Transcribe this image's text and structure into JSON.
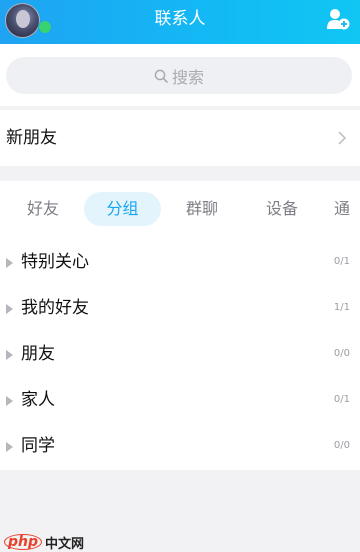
{
  "header": {
    "title": "联系人",
    "colors": {
      "gradient_start": "#1fa3f2",
      "gradient_end": "#10c6f3"
    },
    "right_icon": "add-user-icon",
    "avatar_status": "online"
  },
  "search": {
    "placeholder": "搜索",
    "icon": "search-icon"
  },
  "new_friends": {
    "label": "新朋友",
    "icon": "chevron-right-icon"
  },
  "tabs": [
    {
      "label": "好友",
      "active": false
    },
    {
      "label": "分组",
      "active": true
    },
    {
      "label": "群聊",
      "active": false
    },
    {
      "label": "设备",
      "active": false
    },
    {
      "label": "通",
      "active": false
    }
  ],
  "groups": [
    {
      "name": "特别关心",
      "count": "0/1"
    },
    {
      "name": "我的好友",
      "count": "1/1"
    },
    {
      "name": "朋友",
      "count": "0/0"
    },
    {
      "name": "家人",
      "count": "0/1"
    },
    {
      "name": "同学",
      "count": "0/0"
    }
  ],
  "watermark": {
    "logo": "php",
    "text": "中文网"
  },
  "accent_color": "#18a7ef"
}
